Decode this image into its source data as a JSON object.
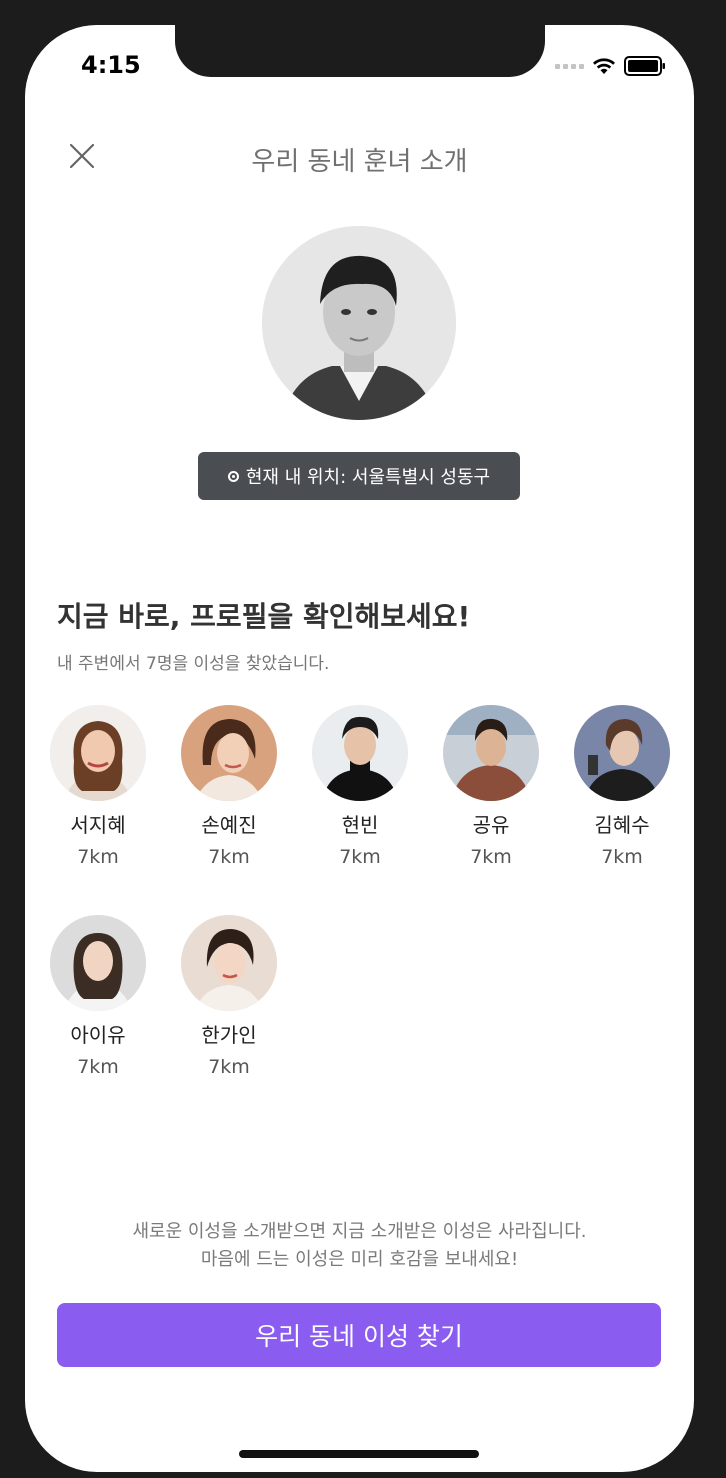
{
  "status_bar": {
    "time": "4:15"
  },
  "header": {
    "title": "우리 동네 훈녀 소개",
    "close_icon": "close-icon"
  },
  "location": {
    "text": "현재 내 위치: 서울특별시 성동구",
    "icon": "location-dot-icon"
  },
  "section": {
    "title": "지금 바로, 프로필을 확인해보세요!",
    "subtitle": "내 주변에서 7명을 이성을 찾았습니다."
  },
  "profiles": [
    {
      "name": "서지혜",
      "distance": "7km"
    },
    {
      "name": "손예진",
      "distance": "7km"
    },
    {
      "name": "현빈",
      "distance": "7km"
    },
    {
      "name": "공유",
      "distance": "7km"
    },
    {
      "name": "김혜수",
      "distance": "7km"
    },
    {
      "name": "아이유",
      "distance": "7km"
    },
    {
      "name": "한가인",
      "distance": "7km"
    }
  ],
  "notice": {
    "line1": "새로운 이성을 소개받으면 지금 소개받은 이성은 사라집니다.",
    "line2": "마음에 드는 이성은 미리 호감을 보내세요!"
  },
  "button": {
    "label": "우리 동네 이성 찾기"
  },
  "colors": {
    "accent": "#8b5cf0",
    "badge_bg": "#4a4e52"
  }
}
